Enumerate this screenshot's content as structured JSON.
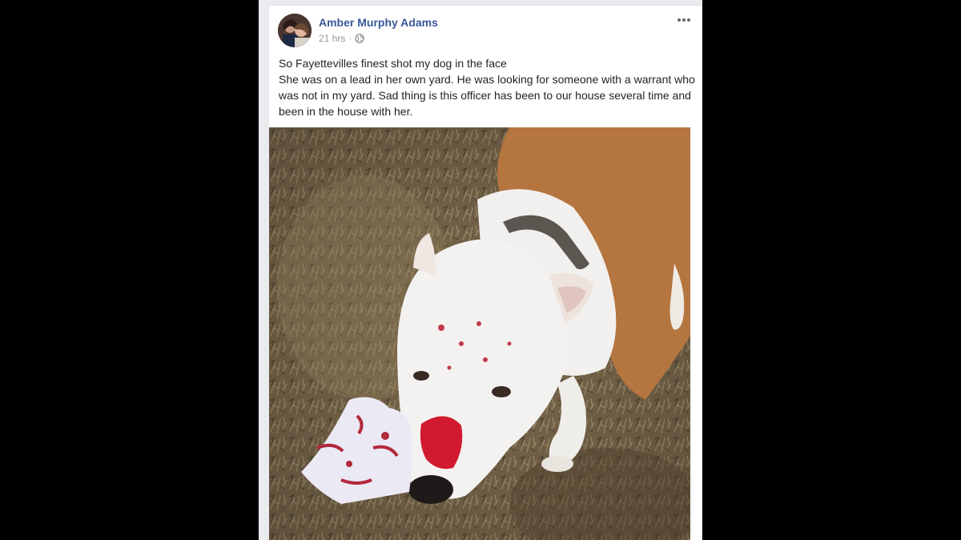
{
  "post": {
    "author_name": "Amber Murphy Adams",
    "timestamp": "21 hrs",
    "separator": "·",
    "privacy_icon": "globe-icon",
    "more_icon": "more-options-icon",
    "text_lines": [
      "So Fayettevilles finest shot my dog in the face",
      "She was on a lead in her own yard. He was looking for someone with a warrant who was not in my yard. Sad thing is this officer has been to our house several time and been in the house with her."
    ],
    "photo_subject": "injured-dog-photo"
  },
  "colors": {
    "author_link": "#385898",
    "meta_text": "#90949c",
    "body_text": "#1d2129",
    "feed_background": "#e9ebee",
    "card_background": "#ffffff",
    "letterbox": "#000000"
  }
}
